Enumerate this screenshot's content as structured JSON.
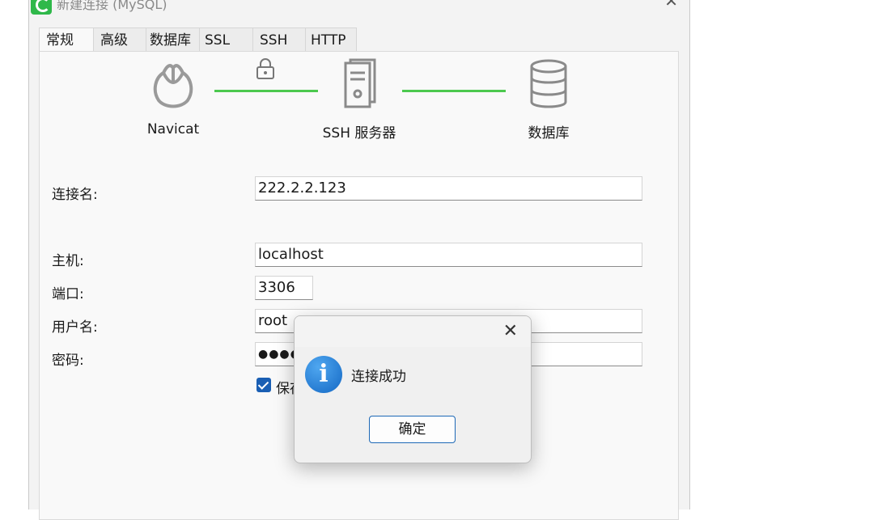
{
  "window": {
    "title": "新建连接 (MySQL)",
    "close_glyph": "✕"
  },
  "tabs": [
    {
      "label": "常规",
      "active": true
    },
    {
      "label": "高级"
    },
    {
      "label": "数据库"
    },
    {
      "label": "SSL"
    },
    {
      "label": "SSH"
    },
    {
      "label": "HTTP"
    }
  ],
  "diagram": {
    "navicat_label": "Navicat",
    "ssh_label": "SSH 服务器",
    "db_label": "数据库",
    "line_color": "#4cc94f"
  },
  "form": {
    "conn_name_label": "连接名:",
    "conn_name_value": "222.2.2.123",
    "host_label": "主机:",
    "host_value": "localhost",
    "port_label": "端口:",
    "port_value": "3306",
    "user_label": "用户名:",
    "user_value": "root",
    "password_label": "密码:",
    "password_value": "●●●●",
    "save_password_label": "保存",
    "save_password_checked": true
  },
  "dialog": {
    "close_glyph": "✕",
    "icon": "info-icon",
    "icon_glyph": "i",
    "message": "连接成功",
    "ok_label": "确定"
  }
}
